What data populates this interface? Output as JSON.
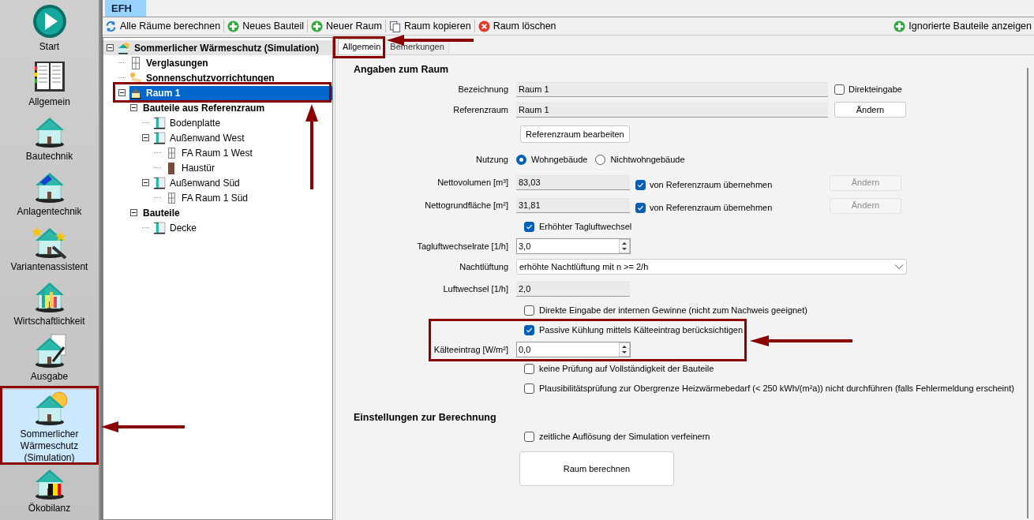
{
  "sidebar": {
    "items": [
      {
        "label": "Start",
        "selected": false
      },
      {
        "label": "Allgemein",
        "selected": false
      },
      {
        "label": "Bautechnik",
        "selected": false
      },
      {
        "label": "Anlagentechnik",
        "selected": false
      },
      {
        "label": "Variantenassistent",
        "selected": false
      },
      {
        "label": "Wirtschaftlichkeit",
        "selected": false
      },
      {
        "label": "Ausgabe",
        "selected": false
      },
      {
        "label": "Sommerlicher Wärmeschutz (Simulation)",
        "selected": true
      },
      {
        "label": "Ökobilanz",
        "selected": false
      }
    ]
  },
  "document_tabs": [
    {
      "label": "EFH",
      "selected": true
    }
  ],
  "toolbar": {
    "left": [
      {
        "label": "Alle Räume berechnen",
        "kind": "refresh"
      },
      {
        "label": "Neues Bauteil",
        "kind": "add"
      },
      {
        "label": "Neuer Raum",
        "kind": "add"
      },
      {
        "label": "Raum kopieren",
        "kind": "copy"
      },
      {
        "label": "Raum löschen",
        "kind": "delete"
      }
    ],
    "right": [
      {
        "label": "Ignorierte Bauteile anzeigen",
        "kind": "add"
      }
    ]
  },
  "tree": [
    {
      "label": "Sommerlicher Wärmeschutz (Simulation)",
      "kind": "simulation",
      "selected": false,
      "expanded": true,
      "children": [
        {
          "label": "Verglasungen",
          "kind": "glazing",
          "selected": false
        },
        {
          "label": "Sonnenschutzvorrichtungen",
          "kind": "shade",
          "selected": false
        },
        {
          "label": "Raum 1",
          "kind": "room",
          "selected": true,
          "expanded": true,
          "children": [
            {
              "label": "Bauteile aus Referenzraum",
              "kind": "group",
              "selected": false,
              "expanded": true,
              "children": [
                {
                  "label": "Bodenplatte",
                  "kind": "wall",
                  "selected": false
                },
                {
                  "label": "Außenwand West",
                  "kind": "wall",
                  "selected": false,
                  "expanded": true,
                  "children": [
                    {
                      "label": "FA Raum 1 West",
                      "kind": "window",
                      "selected": false
                    },
                    {
                      "label": "Haustür",
                      "kind": "door",
                      "selected": false
                    }
                  ]
                },
                {
                  "label": "Außenwand Süd",
                  "kind": "wall",
                  "selected": false,
                  "expanded": true,
                  "children": [
                    {
                      "label": "FA Raum 1 Süd",
                      "kind": "window",
                      "selected": false
                    }
                  ]
                }
              ]
            },
            {
              "label": "Bauteile",
              "kind": "group",
              "selected": false,
              "expanded": true,
              "children": [
                {
                  "label": "Decke",
                  "kind": "wall",
                  "selected": false
                }
              ]
            }
          ]
        }
      ]
    }
  ],
  "tabs": [
    {
      "label": "Allgemein",
      "selected": true
    },
    {
      "label": "Bemerkungen",
      "selected": false
    }
  ],
  "sections": [
    {
      "title": "Angaben zum Raum",
      "rows": [
        {
          "kind": "wide_field",
          "label": "Bezeichnung",
          "value": "Raum 1",
          "checkbox": {
            "label": "Direkteingabe",
            "checked": false
          }
        },
        {
          "kind": "wide_field",
          "label": "Referenzraum",
          "value": "Raum 1",
          "button": {
            "label": "Ändern",
            "disabled": false
          }
        },
        {
          "kind": "button",
          "label": "Referenzraum bearbeiten"
        },
        {
          "kind": "radio",
          "label": "Nutzung",
          "options": [
            {
              "label": "Wohngebäude",
              "selected": true
            },
            {
              "label": "Nichtwohngebäude",
              "selected": false
            }
          ]
        },
        {
          "kind": "field",
          "label": "Nettovolumen [m³]",
          "value": "83,03",
          "checkbox": {
            "label": "von Referenzraum übernehmen",
            "checked": true
          },
          "button": {
            "label": "Ändern",
            "disabled": true
          }
        },
        {
          "kind": "field",
          "label": "Nettogrundfläche [m²]",
          "value": "31,81",
          "checkbox": {
            "label": "von Referenzraum übernehmen",
            "checked": true
          },
          "button": {
            "label": "Ändern",
            "disabled": true
          }
        },
        {
          "kind": "check",
          "label": "Erhöhter Tagluftwechsel",
          "checked": true
        },
        {
          "kind": "spin",
          "label": "Tagluftwechselrate [1/h]",
          "value": "3,0"
        },
        {
          "kind": "select",
          "label": "Nachtlüftung",
          "value": "erhöhte Nachtlüftung mit n >= 2/h"
        },
        {
          "kind": "field",
          "label": "Luftwechsel [1/h]",
          "value": "2,0"
        },
        {
          "kind": "check",
          "label": "Direkte Eingabe der internen Gewinne (nicht zum Nachweis geeignet)",
          "checked": false
        },
        {
          "kind": "check",
          "label": "Passive Kühlung mittels Kälteeintrag berücksichtigen",
          "checked": true
        },
        {
          "kind": "spin",
          "label": "Kälteeintrag [W/m²]",
          "value": "0,0"
        },
        {
          "kind": "check",
          "label": "keine Prüfung auf Vollständigkeit der Bauteile",
          "checked": false
        },
        {
          "kind": "check",
          "label": "Plausibilitätsprüfung zur Obergrenze Heizwärmebedarf (< 250 kWh/(m²a)) nicht durchführen (falls Fehlermeldung erscheint)",
          "checked": false
        }
      ]
    },
    {
      "title": "Einstellungen zur Berechnung",
      "rows": [
        {
          "kind": "check",
          "label": "zeitliche Auflösung der Simulation verfeinern",
          "checked": false
        },
        {
          "kind": "big_button",
          "label": "Raum berechnen"
        }
      ]
    }
  ]
}
